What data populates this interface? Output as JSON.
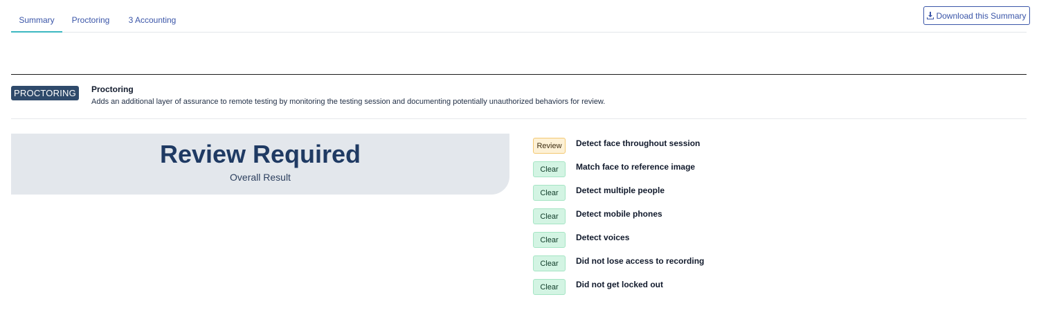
{
  "tabs": [
    {
      "label": "Summary",
      "active": true
    },
    {
      "label": "Proctoring",
      "active": false
    },
    {
      "label": "3 Accounting",
      "active": false
    }
  ],
  "download_button": {
    "label": "Download this Summary",
    "icon": "download-icon"
  },
  "section": {
    "badge": "PROCTORING",
    "title": "Proctoring",
    "description": "Adds an additional layer of assurance to remote testing by monitoring the testing session and documenting potentially unauthorized behaviors for review."
  },
  "result": {
    "main": "Review Required",
    "sub": "Overall Result"
  },
  "checks": [
    {
      "status": "Review",
      "label": "Detect face throughout session"
    },
    {
      "status": "Clear",
      "label": "Match face to reference image"
    },
    {
      "status": "Clear",
      "label": "Detect multiple people"
    },
    {
      "status": "Clear",
      "label": "Detect mobile phones"
    },
    {
      "status": "Clear",
      "label": "Detect voices"
    },
    {
      "status": "Clear",
      "label": "Did not lose access to recording"
    },
    {
      "status": "Clear",
      "label": "Did not get locked out"
    }
  ],
  "colors": {
    "accent": "#3bb7c0",
    "link": "#3a55a8",
    "badge_bg": "#2f4a6b",
    "review_bg": "#fdf1d6",
    "clear_bg": "#d3f4e3"
  }
}
